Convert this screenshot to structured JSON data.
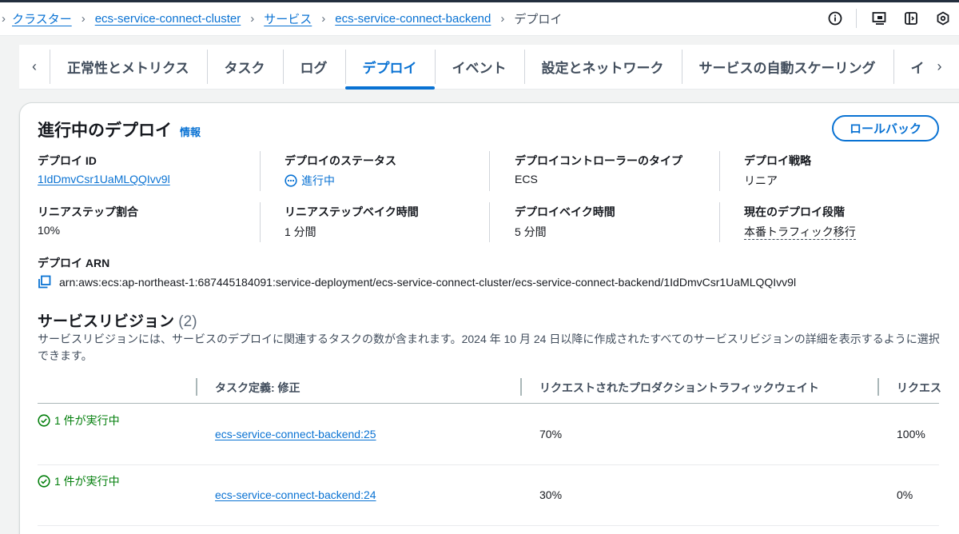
{
  "breadcrumb": {
    "items": [
      "クラスター",
      "ecs-service-connect-cluster",
      "サービス",
      "ecs-service-connect-backend"
    ],
    "current": "デプロイ"
  },
  "top_icons": [
    "info-icon",
    "screenshot-icon",
    "panel-icon",
    "settings-icon"
  ],
  "tabs": {
    "items": [
      "正常性とメトリクス",
      "タスク",
      "ログ",
      "デプロイ",
      "イベント",
      "設定とネットワーク",
      "サービスの自動スケーリング",
      "イ"
    ],
    "active": "デプロイ"
  },
  "deployment": {
    "title": "進行中のデプロイ",
    "info_label": "情報",
    "rollback_label": "ロールバック",
    "fields": [
      {
        "label": "デプロイ ID",
        "value": "1IdDmvCsr1UaMLQQIvv9l"
      },
      {
        "label": "デプロイのステータス",
        "value": "進行中"
      },
      {
        "label": "デプロイコントローラーのタイプ",
        "value": "ECS"
      },
      {
        "label": "デプロイ戦略",
        "value": "リニア"
      },
      {
        "label": "リニアステップ割合",
        "value": "10%"
      },
      {
        "label": "リニアステップベイク時間",
        "value": "1 分間"
      },
      {
        "label": "デプロイベイク時間",
        "value": "5 分間"
      },
      {
        "label": "現在のデプロイ段階",
        "value": "本番トラフィック移行"
      }
    ],
    "arn_label": "デプロイ ARN",
    "arn_value": "arn:aws:ecs:ap-northeast-1:687445184091:service-deployment/ecs-service-connect-cluster/ecs-service-connect-backend/1IdDmvCsr1UaMLQQIvv9l"
  },
  "revisions": {
    "title": "サービスリビジョン",
    "count": "(2)",
    "description": "サービスリビジョンには、サービスのデプロイに関連するタスクの数が含まれます。2024 年 10 月 24 日以降に作成されたすべてのサービスリビジョンの詳細を表示するように選択できます。",
    "columns": [
      "タスク定義: 修正",
      "リクエストされたプロダクショントラフィックウェイト",
      "リクエス"
    ],
    "rows": [
      {
        "status": "1 件が実行中",
        "task_def": "ecs-service-connect-backend:25",
        "weight": "70%",
        "requested": "100%"
      },
      {
        "status": "1 件が実行中",
        "task_def": "ecs-service-connect-backend:24",
        "weight": "30%",
        "requested": "0%"
      }
    ]
  },
  "colors": {
    "link": "#0972d3",
    "success": "#037f0c",
    "text": "#16191f"
  }
}
